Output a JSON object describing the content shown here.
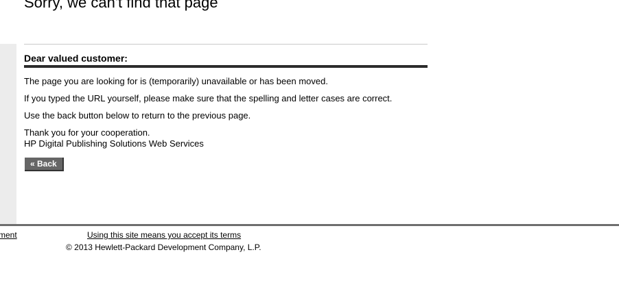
{
  "header": {
    "title": "Sorry, we can't find that page"
  },
  "message": {
    "greeting": "Dear valued customer:",
    "paragraphs": [
      "The page you are looking for is (temporarily) unavailable or has been moved.",
      "If you typed the URL yourself, please make sure that the spelling and letter cases are correct.",
      "Use the back button below to return to the previous page."
    ],
    "closing": "Thank you for your cooperation.",
    "signature": "HP Digital Publishing Solutions Web Services",
    "back_label": "« Back"
  },
  "footer": {
    "left_link_fragment": "ment",
    "terms_link": "Using this site means you accept its terms",
    "copyright": "© 2013 Hewlett-Packard Development Company, L.P."
  }
}
